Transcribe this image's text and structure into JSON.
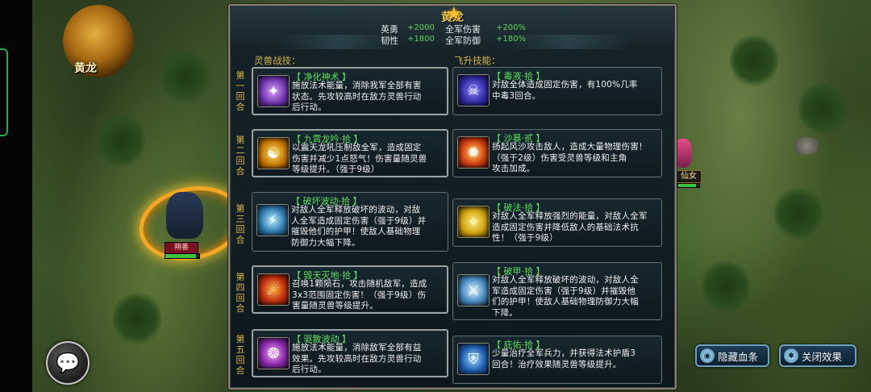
{
  "dragon_portrait": {
    "name": "黄龙",
    "icon": "golden-dragon-portrait"
  },
  "battlefield": {
    "ally_unit_label": "朔番",
    "ally_hp_fraction": 0.9,
    "enemy_unit_label": "仙女",
    "enemy_hp_fraction": 0.85
  },
  "panel": {
    "title": "黄龙",
    "title_icon": "star-icon",
    "stats": [
      {
        "name": "英勇",
        "value": "+2000"
      },
      {
        "name": "全军伤害",
        "value": "+200%"
      },
      {
        "name": "韧性",
        "value": "+1800"
      },
      {
        "name": "全军防御",
        "value": "+180%"
      }
    ],
    "left_section_label": "灵兽战技：",
    "right_section_label": "飞升技能：",
    "rounds": [
      {
        "label": "第一回合",
        "left": {
          "name": "【 净化神术 】",
          "desc": "施放法术能量，消除我军全部有害\n状态。先攻较高时在敌方灵兽行动\n后行动。",
          "icon": "purification-icon"
        },
        "right": {
          "name": "【 毒液·拾 】",
          "desc": "对敌全体造成固定伤害，有100%几率\n中毒3回合。",
          "icon": "poison-venom-icon"
        }
      },
      {
        "label": "第二回合",
        "left": {
          "name": "【 九霄龙吟·拾 】",
          "desc": "以震天龙吼压制敌全军，造成固定\n伤害并减少1点怒气！伤害量随灵兽\n等级提升。（强于9级）",
          "icon": "dragon-roar-icon"
        },
        "right": {
          "name": "【 沙暴·贰 】",
          "desc": "扬起风沙攻击敌人，造成大量物理伤害！\n（强于2级）伤害受灵兽等级和主角\n攻击加成。",
          "icon": "sandstorm-icon"
        }
      },
      {
        "label": "第三回合",
        "left": {
          "name": "【 破坏波动·拾 】",
          "desc": "对敌人全军释放破坏的波动，对敌\n人全军造成固定伤害（强于9级）并\n摧毁他们的护甲！使敌人基础物理\n防御力大幅下降。",
          "icon": "destruction-wave-icon"
        },
        "right": {
          "name": "【 破法·拾 】",
          "desc": "对敌人全军释放强烈的能量，对敌人全军\n造成固定伤害并降低敌人的基础法术抗\n性！（强于9级）",
          "icon": "spell-break-icon"
        }
      },
      {
        "label": "第四回合",
        "left": {
          "name": "【 毁天灭地·拾 】",
          "desc": "召唤1颗陨石，攻击随机敌军，造成\n3x3范围固定伤害！（强于9级）伤\n害量随灵兽等级提升。",
          "icon": "meteor-icon"
        },
        "right": {
          "name": "【 破甲·拾 】",
          "desc": "对敌人全军释放破坏的波动，对敌人全\n军造成固定伤害（强于9级）并摧毁他\n们的护甲！使敌人基础物理防御力大幅\n下降。",
          "icon": "armor-break-icon"
        }
      },
      {
        "label": "第五回合",
        "left": {
          "name": "【 驱散波动 】",
          "desc": "施放法术能量，消除敌军全部有益\n效果。先攻较高时在敌方灵兽行动\n后行动。",
          "icon": "dispel-wave-icon"
        },
        "right": {
          "name": "【 庇佑·拾 】",
          "desc": "少量治疗全军兵力，并获得法术护盾3\n回合！治疗效果随灵兽等级提升。",
          "icon": "blessing-shield-icon"
        }
      }
    ]
  },
  "buttons": {
    "hide_hp": "隐藏血条",
    "close_effects": "关闭效果",
    "chat_icon": "chat-bubble-icon"
  },
  "colors": {
    "gold_text": "#d7b64a",
    "skill_name_green": "#5fe05f",
    "stat_value_green": "#5fd05f"
  }
}
